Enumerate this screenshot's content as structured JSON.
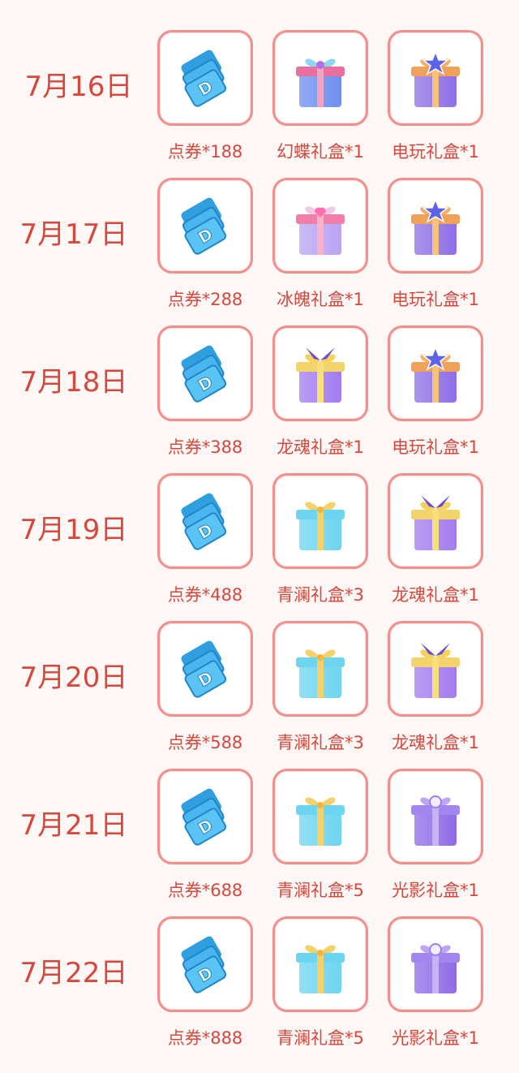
{
  "days": [
    {
      "date": "7月16日",
      "rewards": [
        {
          "label": "点券*188",
          "icon": "coupon-icon"
        },
        {
          "label": "幻蝶礼盒*1",
          "icon": "butterfly-gift-box-icon"
        },
        {
          "label": "电玩礼盒*1",
          "icon": "star-gift-box-icon"
        }
      ]
    },
    {
      "date": "7月17日",
      "rewards": [
        {
          "label": "点券*288",
          "icon": "coupon-icon"
        },
        {
          "label": "冰魄礼盒*1",
          "icon": "heart-gift-box-icon"
        },
        {
          "label": "电玩礼盒*1",
          "icon": "star-gift-box-icon"
        }
      ]
    },
    {
      "date": "7月18日",
      "rewards": [
        {
          "label": "点券*388",
          "icon": "coupon-icon"
        },
        {
          "label": "龙魂礼盒*1",
          "icon": "dragon-gift-box-icon"
        },
        {
          "label": "电玩礼盒*1",
          "icon": "star-gift-box-icon"
        }
      ]
    },
    {
      "date": "7月19日",
      "rewards": [
        {
          "label": "点券*488",
          "icon": "coupon-icon"
        },
        {
          "label": "青澜礼盒*3",
          "icon": "blue-gift-box-icon"
        },
        {
          "label": "龙魂礼盒*1",
          "icon": "dragon-gift-box-icon"
        }
      ]
    },
    {
      "date": "7月20日",
      "rewards": [
        {
          "label": "点券*588",
          "icon": "coupon-icon"
        },
        {
          "label": "青澜礼盒*3",
          "icon": "blue-gift-box-icon"
        },
        {
          "label": "龙魂礼盒*1",
          "icon": "dragon-gift-box-icon"
        }
      ]
    },
    {
      "date": "7月21日",
      "rewards": [
        {
          "label": "点券*688",
          "icon": "coupon-icon"
        },
        {
          "label": "青澜礼盒*5",
          "icon": "blue-gift-box-icon"
        },
        {
          "label": "光影礼盒*1",
          "icon": "pearl-gift-box-icon"
        }
      ]
    },
    {
      "date": "7月22日",
      "rewards": [
        {
          "label": "点券*888",
          "icon": "coupon-icon"
        },
        {
          "label": "青澜礼盒*5",
          "icon": "blue-gift-box-icon"
        },
        {
          "label": "光影礼盒*1",
          "icon": "pearl-gift-box-icon"
        }
      ]
    }
  ],
  "colors": {
    "accent": "#d6473c",
    "tile_border": "#f08f8b",
    "background": "#fdf8f6"
  }
}
